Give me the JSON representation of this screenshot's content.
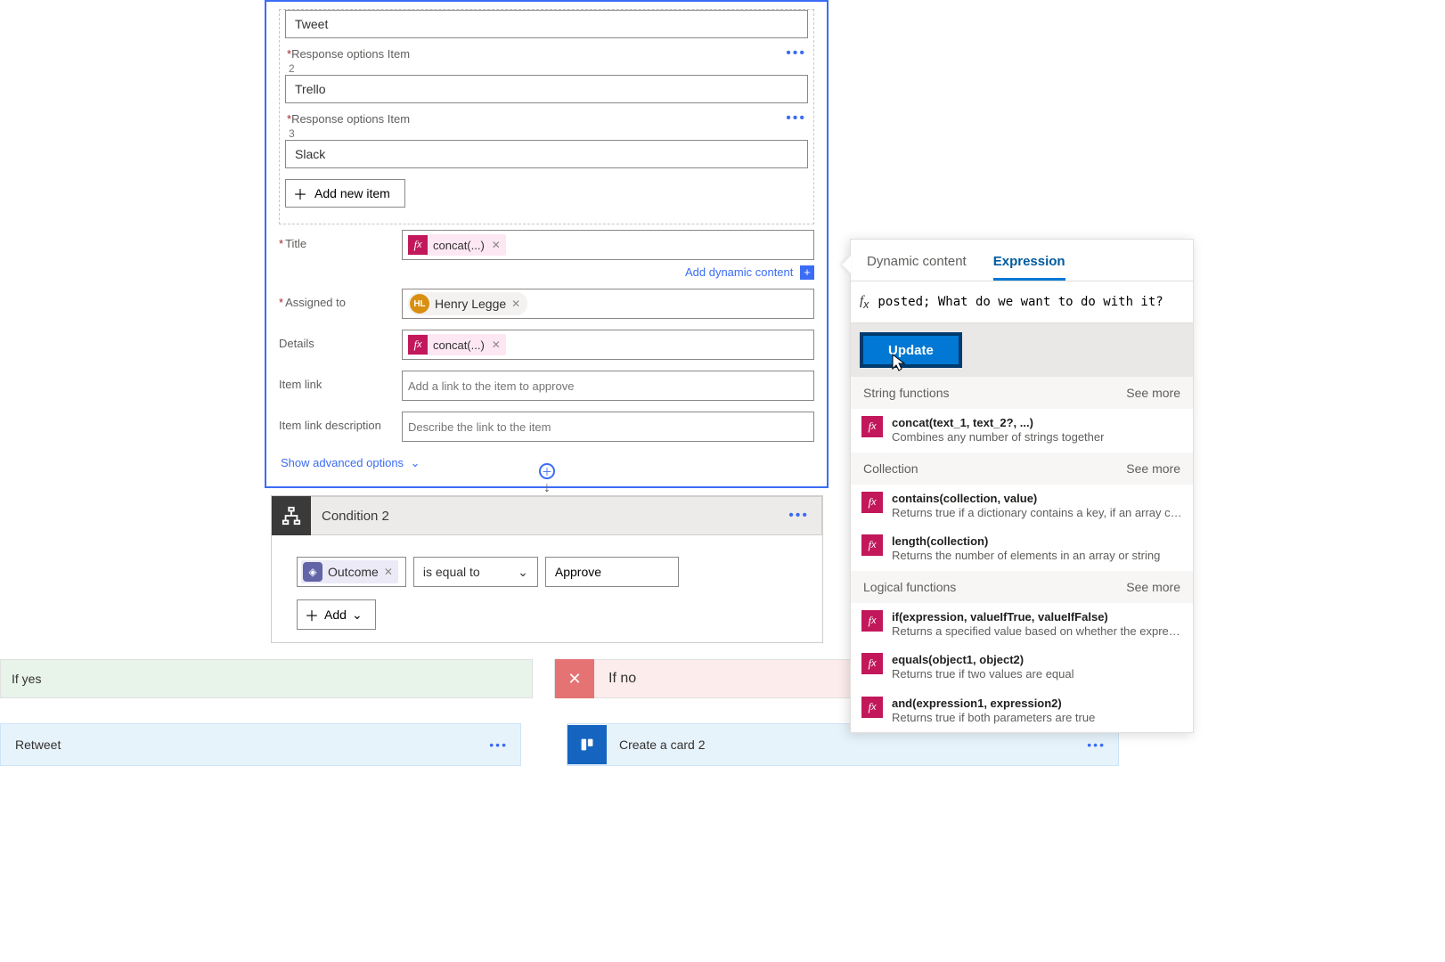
{
  "approval": {
    "response_items": [
      {
        "label": "",
        "value": "Tweet"
      },
      {
        "label": "Response options Item",
        "sub": "2",
        "value": "Trello"
      },
      {
        "label": "Response options Item",
        "sub": "3",
        "value": "Slack"
      }
    ],
    "add_item_label": "Add new item",
    "title_label": "Title",
    "title_chip": "concat(...)",
    "dyn_link": "Add dynamic content",
    "assigned_label": "Assigned to",
    "assigned_initials": "HL",
    "assigned_name": "Henry Legge",
    "details_label": "Details",
    "details_chip": "concat(...)",
    "item_link_label": "Item link",
    "item_link_placeholder": "Add a link to the item to approve",
    "item_link_desc_label": "Item link description",
    "item_link_desc_placeholder": "Describe the link to the item",
    "show_advanced": "Show advanced options"
  },
  "condition": {
    "title": "Condition 2",
    "variable": "Outcome",
    "operator": "is equal to",
    "value": "Approve",
    "add_label": "Add"
  },
  "branches": {
    "yes": "If yes",
    "no": "If no"
  },
  "actions": {
    "retweet": "Retweet",
    "create_card": "Create a card 2"
  },
  "expr": {
    "tab_dynamic": "Dynamic content",
    "tab_expression": "Expression",
    "input": "posted; What do we want to do with it?",
    "update": "Update",
    "sections": {
      "string": "String functions",
      "collection": "Collection",
      "logical": "Logical functions",
      "see_more": "See more"
    },
    "fns": {
      "concat_sig": "concat(text_1, text_2?, ...)",
      "concat_desc": "Combines any number of strings together",
      "contains_sig": "contains(collection, value)",
      "contains_desc": "Returns true if a dictionary contains a key, if an array cont..",
      "length_sig": "length(collection)",
      "length_desc": "Returns the number of elements in an array or string",
      "if_sig": "if(expression, valueIfTrue, valueIfFalse)",
      "if_desc": "Returns a specified value based on whether the expressio..",
      "equals_sig": "equals(object1, object2)",
      "equals_desc": "Returns true if two values are equal",
      "and_sig": "and(expression1, expression2)",
      "and_desc": "Returns true if both parameters are true"
    }
  }
}
